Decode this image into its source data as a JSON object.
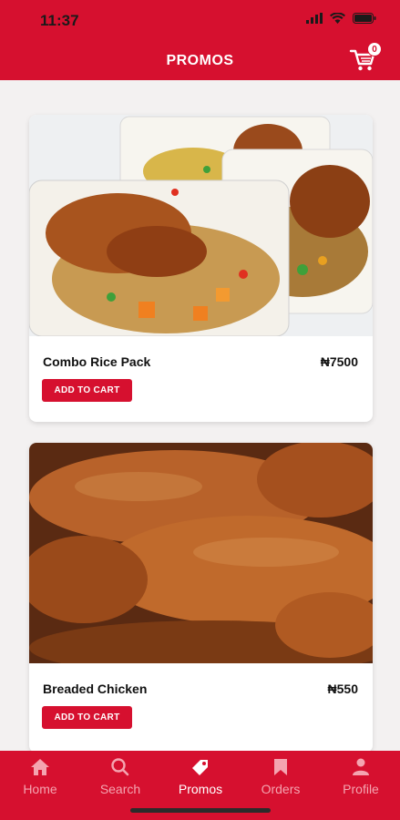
{
  "status": {
    "time": "11:37"
  },
  "header": {
    "title": "PROMOS",
    "cart_count": "0"
  },
  "products": [
    {
      "name": "Combo Rice Pack",
      "price": "₦7500",
      "button": "ADD TO CART"
    },
    {
      "name": "Breaded Chicken",
      "price": "₦550",
      "button": "ADD TO CART"
    }
  ],
  "tabs": [
    {
      "label": "Home",
      "icon": "home-icon"
    },
    {
      "label": "Search",
      "icon": "search-icon"
    },
    {
      "label": "Promos",
      "icon": "tag-icon"
    },
    {
      "label": "Orders",
      "icon": "bookmark-icon"
    },
    {
      "label": "Profile",
      "icon": "person-icon"
    }
  ],
  "active_tab": "Promos",
  "colors": {
    "accent": "#d6102f",
    "tab_inactive": "#f4a4b0"
  }
}
